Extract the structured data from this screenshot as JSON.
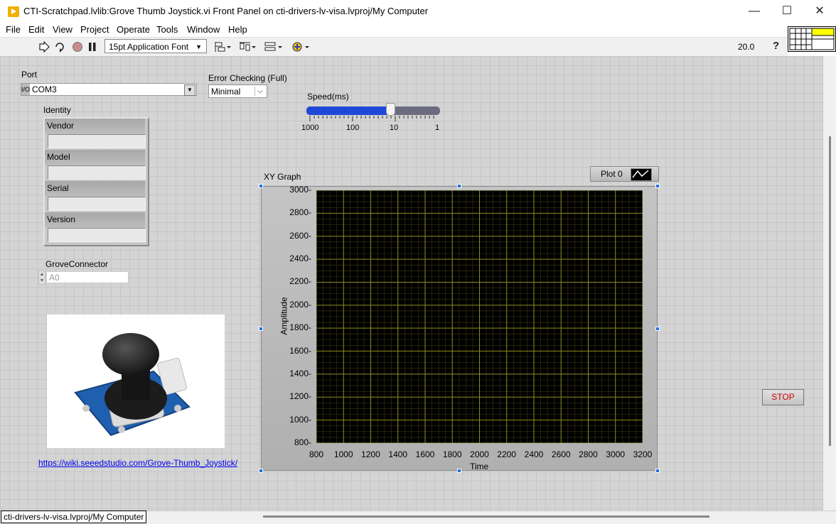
{
  "window": {
    "title": "CTI-Scratchpad.lvlib:Grove Thumb Joystick.vi Front Panel on cti-drivers-lv-visa.lvproj/My Computer",
    "minimize_glyph": "—",
    "maximize_glyph": "☐",
    "close_glyph": "✕"
  },
  "menu": [
    "File",
    "Edit",
    "View",
    "Project",
    "Operate",
    "Tools",
    "Window",
    "Help"
  ],
  "toolbar": {
    "font": "15pt Application Font",
    "zoom": "20.0",
    "help_glyph": "?"
  },
  "panel": {
    "port": {
      "label": "Port",
      "io_glyph": "I/O",
      "value": "COM3"
    },
    "error_checking": {
      "label": "Error Checking (Full)",
      "value": "Minimal"
    },
    "speed": {
      "label": "Speed(ms)",
      "scale": [
        "1000",
        "100",
        "10",
        "1"
      ],
      "fraction": 0.63
    },
    "identity": {
      "label": "Identity",
      "fields": [
        {
          "label": "Vendor",
          "value": ""
        },
        {
          "label": "Model",
          "value": ""
        },
        {
          "label": "Serial",
          "value": ""
        },
        {
          "label": "Version",
          "value": ""
        }
      ]
    },
    "grove_connector": {
      "label": "GroveConnector",
      "value": "A0"
    },
    "link": "https://wiki.seeedstudio.com/Grove-Thumb_Joystick/",
    "stop_label": "STOP"
  },
  "status_bar": "cti-drivers-lv-visa.lvproj/My Computer",
  "colors": {
    "plot_bg": "#000000",
    "grid": "#8c8c1e",
    "slider_fill": "#2048d8",
    "stop_text": "#d00000"
  },
  "chart_data": {
    "type": "scatter",
    "title": "XY Graph",
    "xlabel": "Time",
    "ylabel": "Amplitude",
    "xlim": [
      800,
      3200
    ],
    "ylim": [
      800,
      3000
    ],
    "x_ticks": [
      "800",
      "1000",
      "1200",
      "1400",
      "1600",
      "1800",
      "2000",
      "2200",
      "2400",
      "2600",
      "2800",
      "3000",
      "3200"
    ],
    "y_ticks": [
      "3000",
      "2800",
      "2600",
      "2400",
      "2200",
      "2000",
      "1800",
      "1600",
      "1400",
      "1200",
      "1000",
      "800"
    ],
    "grid": true,
    "legend": "top-right",
    "series": [
      {
        "name": "Plot 0",
        "x": [],
        "y": []
      }
    ]
  }
}
